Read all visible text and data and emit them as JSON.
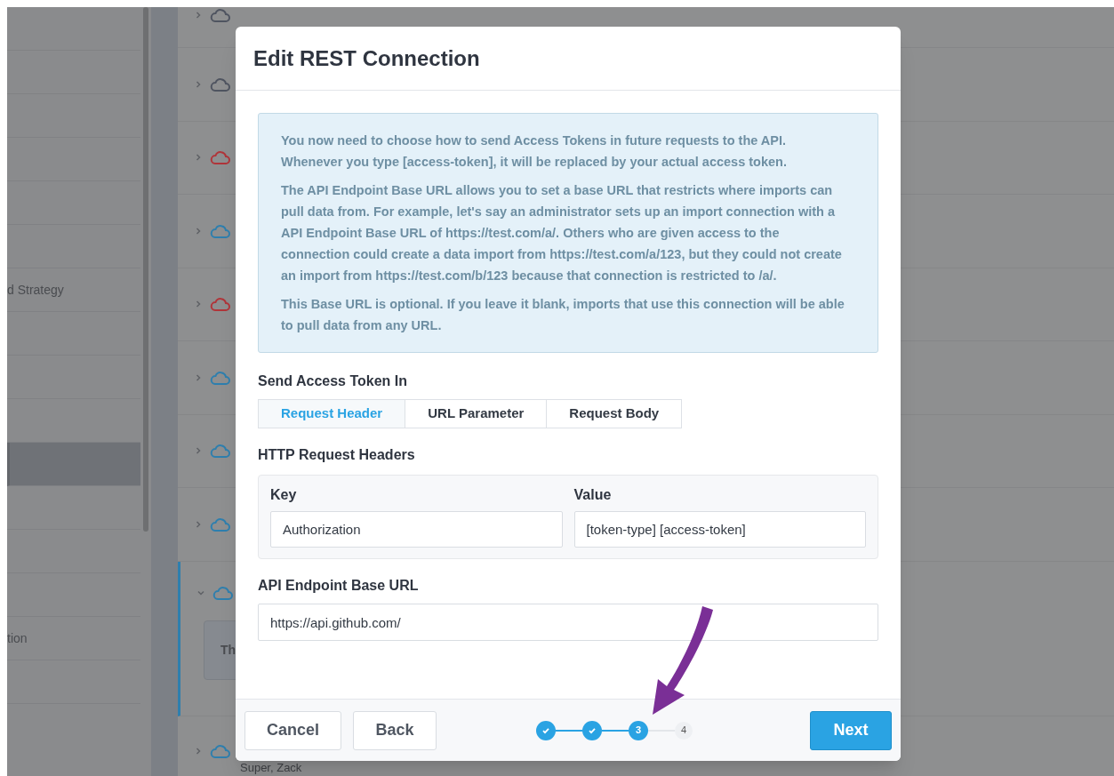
{
  "sidebar": {
    "items": [
      {
        "selected": false
      },
      {
        "selected": false
      },
      {
        "selected": false
      },
      {
        "selected": false
      },
      {
        "selected": false
      },
      {
        "selected": false
      },
      {
        "label": "d Strategy",
        "selected": false
      },
      {
        "selected": false
      },
      {
        "selected": false
      },
      {
        "selected": false
      },
      {
        "selected": true
      },
      {
        "selected": false
      },
      {
        "selected": false
      },
      {
        "selected": false
      },
      {
        "label": "tion",
        "selected": false
      },
      {
        "selected": false
      }
    ]
  },
  "connections": [
    {
      "color": "#4f5460",
      "expanded": false
    },
    {
      "color": "#4f5460",
      "expanded": false
    },
    {
      "color": "#b0353a",
      "expanded": false
    },
    {
      "color": "#2e7fae",
      "expanded": false
    },
    {
      "color": "#b0353a",
      "expanded": false
    },
    {
      "color": "#2e7fae",
      "expanded": false
    },
    {
      "color": "#2e7fae",
      "expanded": false
    },
    {
      "color": "#2e7fae",
      "expanded": false
    },
    {
      "color": "#2e7fae",
      "expanded": true,
      "note": "Th"
    },
    {
      "color": "#2e7fae",
      "expanded": false,
      "subtitle": "Super, Zack"
    }
  ],
  "dialog": {
    "title": "Edit REST Connection",
    "info": [
      "You now need to choose how to send Access Tokens in future requests to the API. Whenever you type [access-token], it will be replaced by your actual access token.",
      "The API Endpoint Base URL allows you to set a base URL that restricts where imports can pull data from. For example, let's say an administrator sets up an import connection with a API Endpoint Base URL of https://test.com/a/. Others who are given access to the connection could create a data import from https://test.com/a/123, but they could not create an import from https://test.com/b/123 because that connection is restricted to /a/.",
      "This Base URL is optional. If you leave it blank, imports that use this connection will be able to pull data from any URL."
    ],
    "token_label": "Send Access Token In",
    "token_tabs": [
      {
        "label": "Request Header",
        "selected": true
      },
      {
        "label": "URL Parameter",
        "selected": false
      },
      {
        "label": "Request Body",
        "selected": false
      }
    ],
    "headers_label": "HTTP Request Headers",
    "headers": {
      "key_label": "Key",
      "value_label": "Value",
      "key": "Authorization",
      "value": "[token-type] [access-token]"
    },
    "base_url_label": "API Endpoint Base URL",
    "base_url": "https://api.github.com/",
    "buttons": {
      "cancel": "Cancel",
      "back": "Back",
      "next": "Next"
    },
    "steps": [
      {
        "completed": true
      },
      {
        "completed": true
      },
      {
        "label": "3",
        "completed": false,
        "current": true
      },
      {
        "label": "4",
        "completed": false,
        "current": false
      }
    ]
  }
}
